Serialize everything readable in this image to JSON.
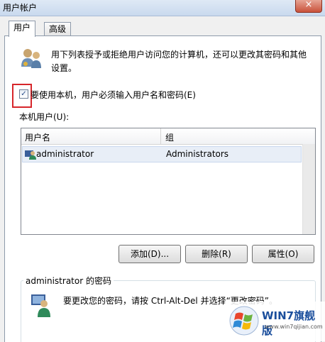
{
  "window": {
    "title": "用户帐户",
    "close_label": "×"
  },
  "tabs": [
    {
      "label": "用户"
    },
    {
      "label": "高级"
    }
  ],
  "description": "用下列表授予或拒绝用户访问您的计算机，还可以更改其密码和其他设置。",
  "require_login": {
    "checked": true,
    "mark": "✓",
    "label": "要使用本机，用户必须输入用户名和密码(E)"
  },
  "list": {
    "label": "本机用户(U):",
    "headers": {
      "name": "用户名",
      "group": "组"
    },
    "rows": [
      {
        "name": "administrator",
        "group": "Administrators"
      }
    ]
  },
  "buttons": {
    "add": "添加(D)...",
    "delete": "删除(R)",
    "properties": "属性(O)"
  },
  "password_group": {
    "title": "administrator 的密码",
    "text": "要更改您的密码，请按 Ctrl-Alt-Del 并选择“更改密码”。"
  },
  "watermark": {
    "title": "WIN7旗舰版",
    "url": "www.win7qijian.com"
  },
  "colors": {
    "highlight": "#d7262b",
    "selection": "#e8eef7"
  }
}
